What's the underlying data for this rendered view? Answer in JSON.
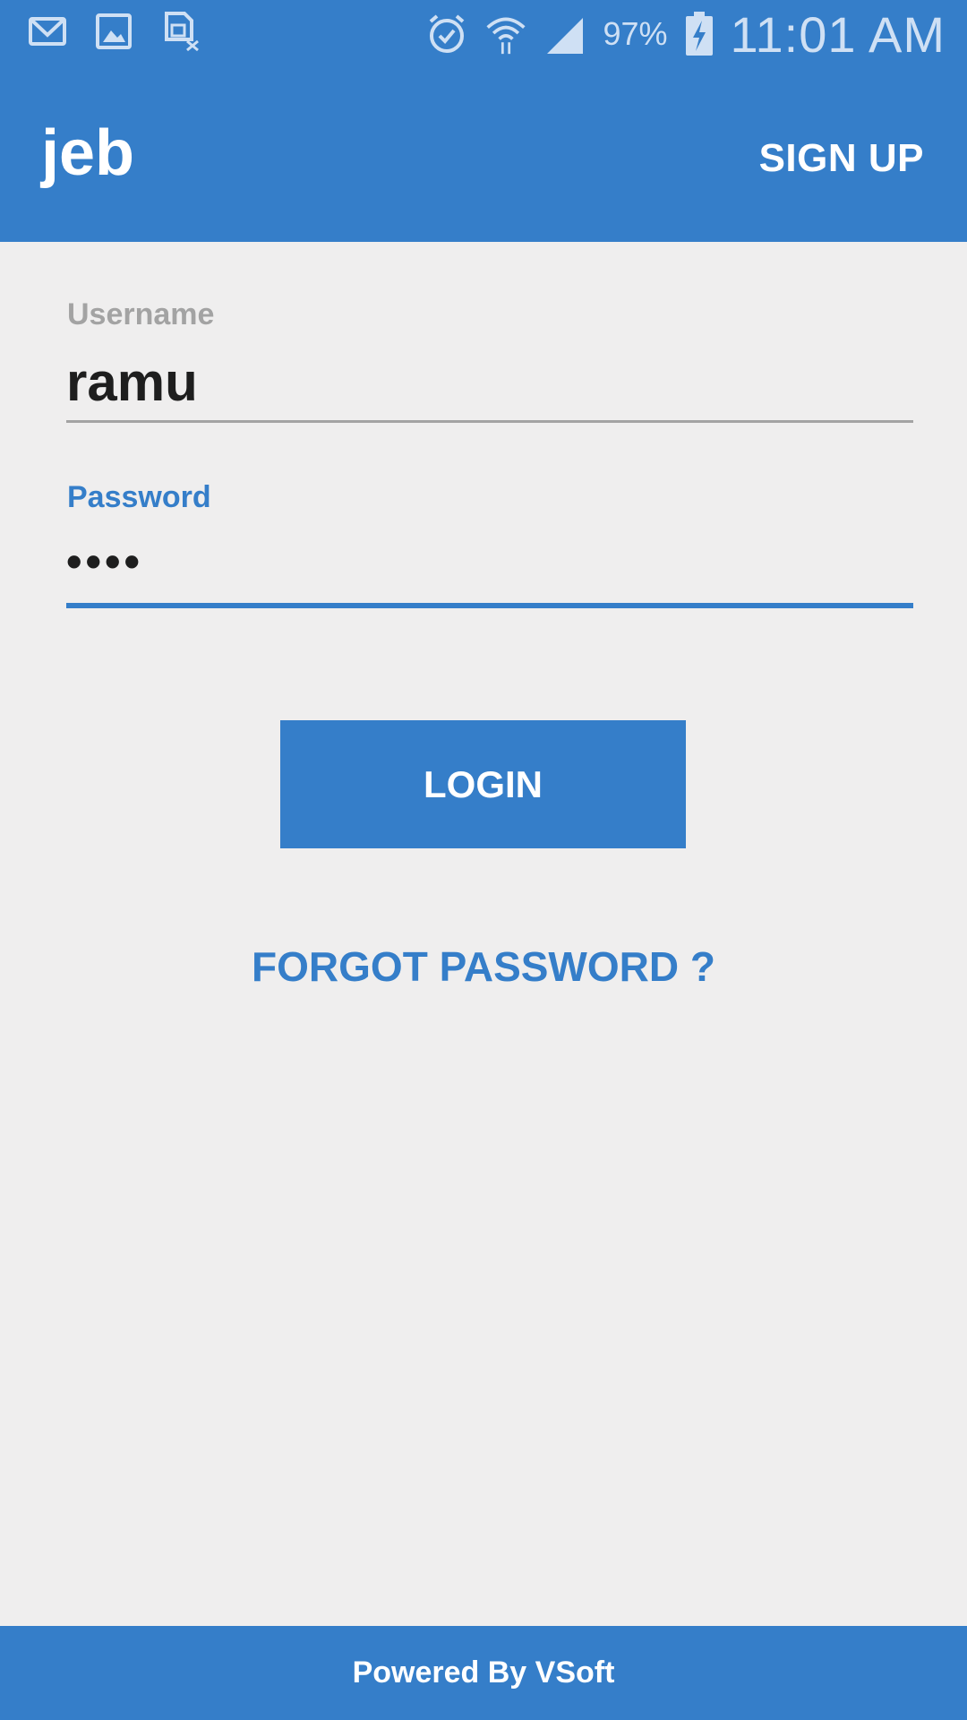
{
  "status_bar": {
    "notification_icons": [
      "gmail-icon",
      "gallery-icon",
      "sim-error-icon"
    ],
    "system_icons": [
      "alarm-icon",
      "wifi-icon",
      "signal-icon"
    ],
    "battery_percent": "97%",
    "time": "11:01 AM"
  },
  "app_bar": {
    "title": "jeb",
    "signup_label": "SIGN UP"
  },
  "login_form": {
    "username_label": "Username",
    "username_value": "ramu",
    "password_label": "Password",
    "password_value": "••••",
    "login_label": "LOGIN",
    "forgot_label": "FORGOT PASSWORD ?"
  },
  "footer": {
    "text": "Powered By VSoft"
  },
  "colors": {
    "primary": "#357ec9",
    "background": "#efeeee",
    "label_inactive": "#a3a3a3",
    "text": "#1e1e1e"
  }
}
